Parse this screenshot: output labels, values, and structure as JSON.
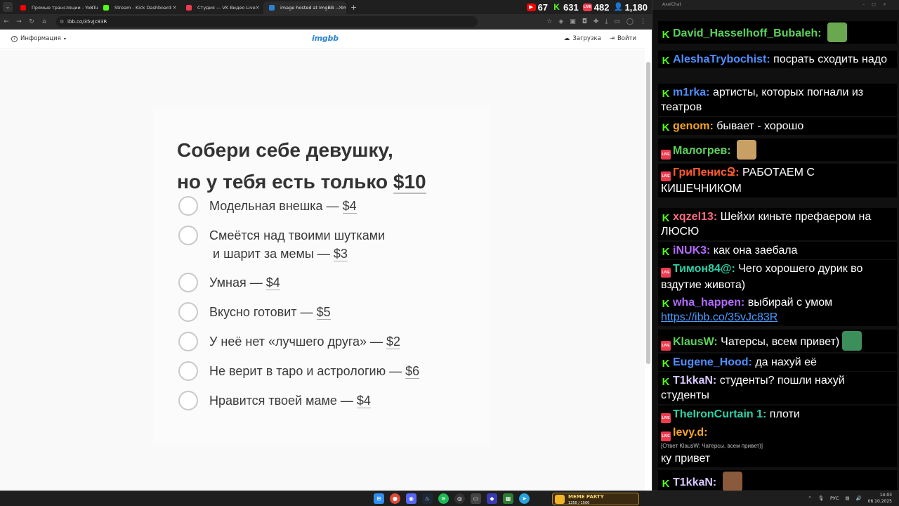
{
  "browser": {
    "tabs": [
      {
        "title": "Прямые трансляции - YouTube",
        "color": "#ff0000"
      },
      {
        "title": "Stream - Kick Dashboard",
        "color": "#53fc18"
      },
      {
        "title": "Студия — VK Видео Live",
        "color": "#ef3b4e"
      },
      {
        "title": "image hosted at ImgBB — Img",
        "color": "#2a84d2"
      }
    ],
    "url": "ibb.co/35vJc83R",
    "stats": {
      "youtube": "67",
      "kick": "631",
      "vk": "482",
      "viewers": "1,180"
    }
  },
  "imgbb": {
    "info_label": "Информация",
    "logo": "imgbb",
    "upload_label": "Загрузка",
    "login_label": "Войти"
  },
  "card": {
    "title_line1": "Собери себе девушку,",
    "title_line2_prefix": "но у тебя есть только ",
    "title_money": "$10",
    "options": [
      {
        "text": "Модельная внешка —",
        "price": "$4"
      },
      {
        "text": "Смеётся над твоими шутками",
        "text2": "и шарит за мемы —",
        "price": "$3"
      },
      {
        "text": "Умная —",
        "price": "$4"
      },
      {
        "text": "Вкусно готовит —",
        "price": "$5"
      },
      {
        "text": "У неё нет «лучшего друга» —",
        "price": "$2"
      },
      {
        "text": "Не верит в таро и астрологию —",
        "price": "$6"
      },
      {
        "text": "Нравится твоей маме —",
        "price": "$4"
      }
    ]
  },
  "chat": {
    "window_title": "AxelChat",
    "messages": [
      {
        "platform": "kick",
        "user": "David_Hasselhoff_Bubaleh:",
        "user_color": "#5ad25a",
        "text": "",
        "emote": "pepe"
      },
      {
        "platform": "kick",
        "user": "AleshaTrybochist:",
        "user_color": "#4f8fff",
        "text": "посрать сходить надо"
      },
      {
        "platform": "kick",
        "user": "m1rka:",
        "user_color": "#4f8fff",
        "text": "артисты, которых погнали из театров"
      },
      {
        "platform": "kick",
        "user": "genom:",
        "user_color": "#f5a623",
        "text": "бывает - хорошо"
      },
      {
        "platform": "vk",
        "user": "Малогрев:",
        "user_color": "#5ad25a",
        "text": "",
        "emote": "dog"
      },
      {
        "platform": "vk",
        "user": "ГриПенисՋ:",
        "user_color": "#ff5a2c",
        "text": "РАБОТАЕМ С КИШЕЧНИКОМ"
      },
      {
        "platform": "kick",
        "user": "xqzel13:",
        "user_color": "#ff6b81",
        "text": "Шейхи киньте префаером на ЛЮСЮ"
      },
      {
        "platform": "kick",
        "user": "iNUK3:",
        "user_color": "#b36bff",
        "text": "как она заебала"
      },
      {
        "platform": "vk",
        "user": "Тимон84@:",
        "user_color": "#2ed0a8",
        "text": "Чего хорошего дурик во вздутие живота)"
      },
      {
        "platform": "kick",
        "user": "wha_happen:",
        "user_color": "#b36bff",
        "text": "выбирай с умом",
        "link": "https://ibb.co/35vJc83R"
      },
      {
        "platform": "vk",
        "user": "KlausW:",
        "user_color": "#5ad25a",
        "text": "Чатерсы, всем привет)",
        "emote": "frog"
      },
      {
        "platform": "kick",
        "user": "Eugene_Hood:",
        "user_color": "#4f8fff",
        "text": "да нахуй её"
      },
      {
        "platform": "kick",
        "user": "T1kkaN:",
        "user_color": "#d9c7ff",
        "text": "студенты? пошли нахуй студенты"
      },
      {
        "platform": "vk",
        "user": "TheIronCurtain 1:",
        "user_color": "#2ed0a8",
        "text": "плоти"
      },
      {
        "platform": "vk",
        "user": "levy.d:",
        "user_color": "#f5a623",
        "text": "ку привет",
        "reply": "[Ответ KlausW: Чатерсы, всем привет)]"
      },
      {
        "platform": "kick",
        "user": "T1kkaN:",
        "user_color": "#d9c7ff",
        "text": "",
        "emote": "face"
      }
    ]
  },
  "taskbar": {
    "meme_party": "MEME PARTY",
    "meme_progress": "1250 / 1500",
    "lang": "РУС",
    "time": "14:03",
    "date": "06.10.2025"
  }
}
